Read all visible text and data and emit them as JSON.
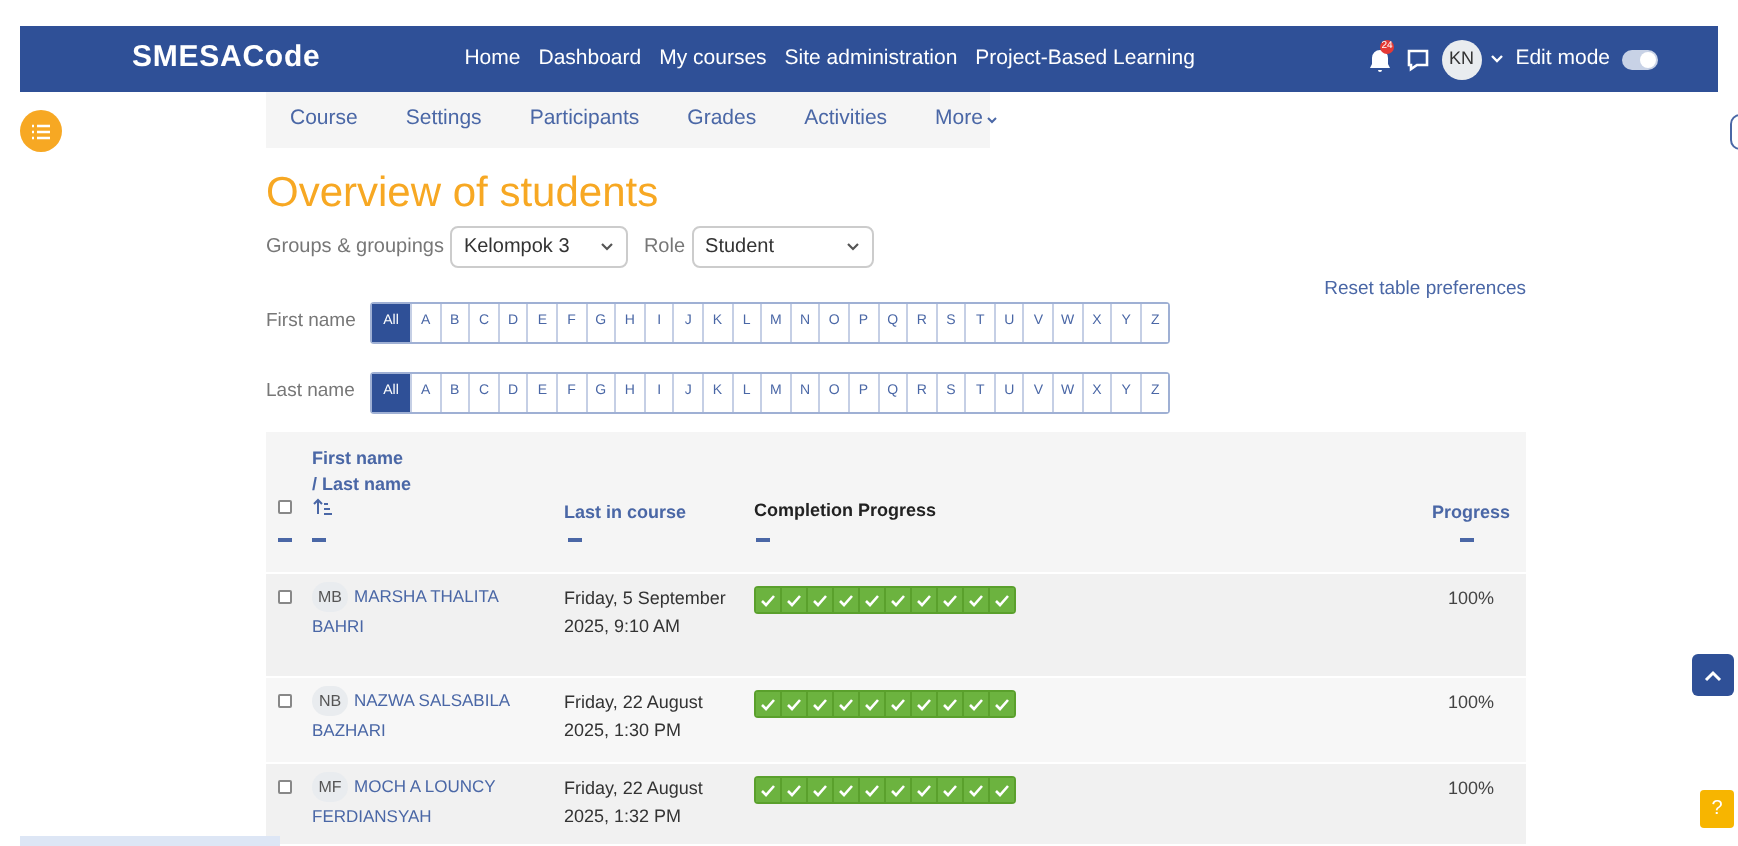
{
  "navbar": {
    "brand": "SMESACode",
    "links": [
      "Home",
      "Dashboard",
      "My courses",
      "Site administration",
      "Project-Based Learning"
    ],
    "notification_count": "24",
    "avatar": "KN",
    "edit_mode": {
      "label": "Edit mode",
      "on": true
    }
  },
  "course_nav": {
    "items": [
      {
        "label": "Course",
        "kind": "link"
      },
      {
        "label": "Settings",
        "kind": "link"
      },
      {
        "label": "Participants",
        "kind": "link"
      },
      {
        "label": "Grades",
        "kind": "link"
      },
      {
        "label": "Activities",
        "kind": "link"
      },
      {
        "label": "More",
        "kind": "menu"
      }
    ]
  },
  "title": "Overview of students",
  "filters": [
    {
      "label": "Groups & groupings",
      "value": "Kelompok 3"
    },
    {
      "label": "Role",
      "value": "Student"
    }
  ],
  "reset_link": "Reset table preferences",
  "initials_bars": [
    {
      "label": "First name",
      "letters": [
        {
          "text": "All",
          "selected": true
        },
        {
          "text": "A",
          "selected": false
        },
        {
          "text": "B",
          "selected": false
        },
        {
          "text": "C",
          "selected": false
        },
        {
          "text": "D",
          "selected": false
        },
        {
          "text": "E",
          "selected": false
        },
        {
          "text": "F",
          "selected": false
        },
        {
          "text": "G",
          "selected": false
        },
        {
          "text": "H",
          "selected": false
        },
        {
          "text": "I",
          "selected": false
        },
        {
          "text": "J",
          "selected": false
        },
        {
          "text": "K",
          "selected": false
        },
        {
          "text": "L",
          "selected": false
        },
        {
          "text": "M",
          "selected": false
        },
        {
          "text": "N",
          "selected": false
        },
        {
          "text": "O",
          "selected": false
        },
        {
          "text": "P",
          "selected": false
        },
        {
          "text": "Q",
          "selected": false
        },
        {
          "text": "R",
          "selected": false
        },
        {
          "text": "S",
          "selected": false
        },
        {
          "text": "T",
          "selected": false
        },
        {
          "text": "U",
          "selected": false
        },
        {
          "text": "V",
          "selected": false
        },
        {
          "text": "W",
          "selected": false
        },
        {
          "text": "X",
          "selected": false
        },
        {
          "text": "Y",
          "selected": false
        },
        {
          "text": "Z",
          "selected": false
        }
      ]
    },
    {
      "label": "Last name",
      "letters": [
        {
          "text": "All",
          "selected": true
        },
        {
          "text": "A",
          "selected": false
        },
        {
          "text": "B",
          "selected": false
        },
        {
          "text": "C",
          "selected": false
        },
        {
          "text": "D",
          "selected": false
        },
        {
          "text": "E",
          "selected": false
        },
        {
          "text": "F",
          "selected": false
        },
        {
          "text": "G",
          "selected": false
        },
        {
          "text": "H",
          "selected": false
        },
        {
          "text": "I",
          "selected": false
        },
        {
          "text": "J",
          "selected": false
        },
        {
          "text": "K",
          "selected": false
        },
        {
          "text": "L",
          "selected": false
        },
        {
          "text": "M",
          "selected": false
        },
        {
          "text": "N",
          "selected": false
        },
        {
          "text": "O",
          "selected": false
        },
        {
          "text": "P",
          "selected": false
        },
        {
          "text": "Q",
          "selected": false
        },
        {
          "text": "R",
          "selected": false
        },
        {
          "text": "S",
          "selected": false
        },
        {
          "text": "T",
          "selected": false
        },
        {
          "text": "U",
          "selected": false
        },
        {
          "text": "V",
          "selected": false
        },
        {
          "text": "W",
          "selected": false
        },
        {
          "text": "X",
          "selected": false
        },
        {
          "text": "Y",
          "selected": false
        },
        {
          "text": "Z",
          "selected": false
        }
      ]
    }
  ],
  "table": {
    "select_all": {
      "checked": false
    },
    "columns": {
      "name_first": "First name",
      "name_last": "/ Last name",
      "last_in_course": "Last in course",
      "completion": "Completion Progress",
      "progress": "Progress"
    },
    "rows": [
      {
        "initials": "MB",
        "name": "MARSHA THALITA BAHRI",
        "last_in_course": "Friday, 5 September 2025, 9:10 AM",
        "checked": false,
        "completion": [
          true,
          true,
          true,
          true,
          true,
          true,
          true,
          true,
          true,
          true
        ],
        "progress": "100%"
      },
      {
        "initials": "NB",
        "name": "NAZWA SALSABILA BAZHARI",
        "last_in_course": "Friday, 22 August 2025, 1:30 PM",
        "checked": false,
        "completion": [
          true,
          true,
          true,
          true,
          true,
          true,
          true,
          true,
          true,
          true
        ],
        "progress": "100%"
      },
      {
        "initials": "MF",
        "name": "MOCH A LOUNCY FERDIANSYAH",
        "last_in_course": "Friday, 22 August 2025, 1:32 PM",
        "checked": false,
        "completion": [
          true,
          true,
          true,
          true,
          true,
          true,
          true,
          true,
          true,
          true
        ],
        "progress": "100%"
      }
    ]
  },
  "help_button": "?"
}
